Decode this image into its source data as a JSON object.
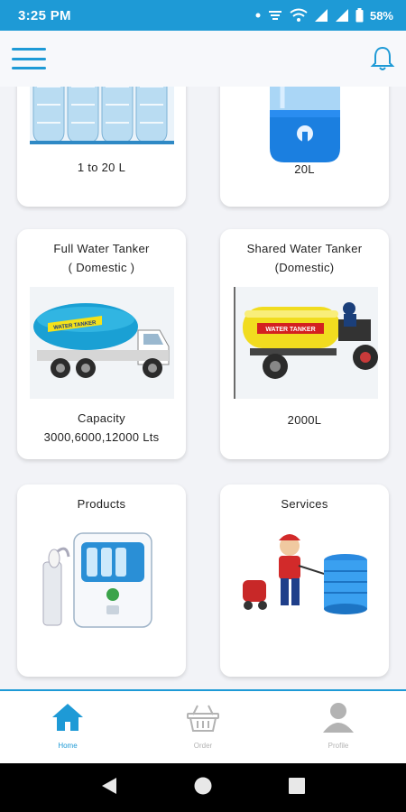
{
  "status_bar": {
    "time": "3:25 PM",
    "battery": "58%",
    "icons": [
      "dot-icon",
      "data-saver-icon",
      "wifi-icon",
      "signal-icon",
      "signal-icon",
      "battery-icon"
    ]
  },
  "app_bar": {
    "menu_icon": "hamburger-menu-icon",
    "notification_icon": "bell-icon"
  },
  "cards": {
    "bottles": {
      "caption": "1 to 20 L"
    },
    "dispenser": {
      "caption": "20L"
    },
    "full_tanker": {
      "title_line1": "Full Water Tanker",
      "title_line2": "( Domestic )",
      "caption_line1": "Capacity",
      "caption_line2": "3000,6000,12000 Lts",
      "truck_text": "WATER TANKER"
    },
    "shared_tanker": {
      "title_line1": "Shared Water Tanker",
      "title_line2": "(Domestic)",
      "caption": "2000L",
      "tractor_text": "WATER TANKER"
    },
    "products": {
      "title": "Products"
    },
    "services": {
      "title": "Services"
    }
  },
  "bottom_nav": {
    "items": [
      {
        "label": "Home",
        "icon": "home-icon",
        "active": true
      },
      {
        "label": "Order",
        "icon": "basket-icon",
        "active": false
      },
      {
        "label": "Profile",
        "icon": "user-icon",
        "active": false
      }
    ]
  },
  "system_nav": [
    "back-icon",
    "home-circle-icon",
    "recents-icon"
  ],
  "colors": {
    "primary": "#1e9ad6",
    "background": "#f2f3f7",
    "card": "#ffffff",
    "inactive": "#b3b3b3",
    "system_nav": "#000000"
  }
}
